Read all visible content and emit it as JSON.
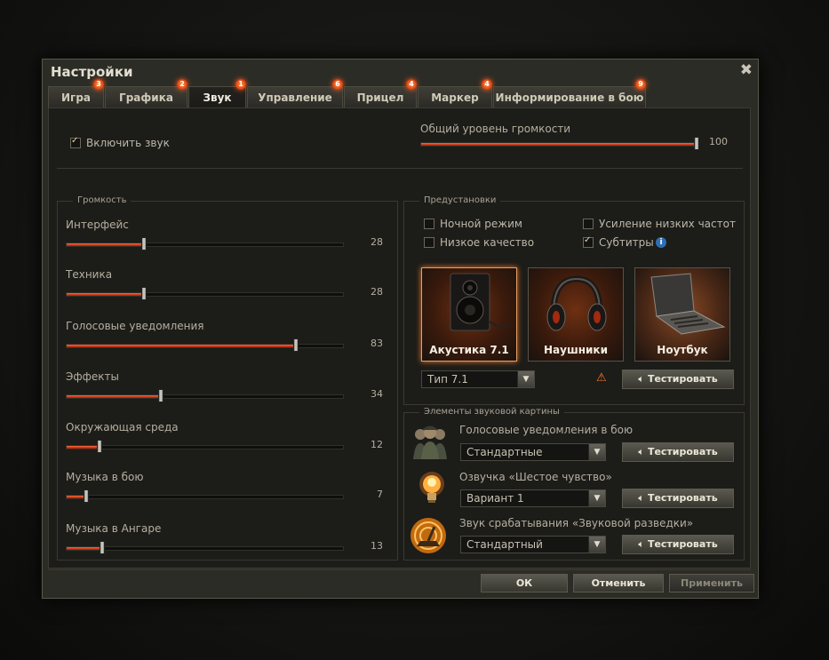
{
  "window": {
    "title": "Настройки"
  },
  "tabs": [
    {
      "label": "Игра",
      "badge": "3",
      "active": false
    },
    {
      "label": "Графика",
      "badge": "2",
      "active": false
    },
    {
      "label": "Звук",
      "badge": "1",
      "active": true
    },
    {
      "label": "Управление",
      "badge": "6",
      "active": false
    },
    {
      "label": "Прицел",
      "badge": "4",
      "active": false
    },
    {
      "label": "Маркер",
      "badge": "4",
      "active": false
    },
    {
      "label": "Информирование в бою",
      "badge": "9",
      "active": false
    }
  ],
  "enable_sound": {
    "label": "Включить звук",
    "checked": true
  },
  "master_volume": {
    "label": "Общий уровень громкости",
    "value": 100
  },
  "volume_group": {
    "title": "Громкость",
    "sliders": [
      {
        "label": "Интерфейс",
        "value": 28
      },
      {
        "label": "Техника",
        "value": 28
      },
      {
        "label": "Голосовые уведомления",
        "value": 83
      },
      {
        "label": "Эффекты",
        "value": 34
      },
      {
        "label": "Окружающая среда",
        "value": 12
      },
      {
        "label": "Музыка в бою",
        "value": 7
      },
      {
        "label": "Музыка в Ангаре",
        "value": 13
      }
    ]
  },
  "presets_group": {
    "title": "Предустановки",
    "checkboxes": {
      "night_mode": {
        "label": "Ночной режим",
        "checked": false
      },
      "bass_boost": {
        "label": "Усиление низких частот",
        "checked": false
      },
      "low_quality": {
        "label": "Низкое качество",
        "checked": false
      },
      "subtitles": {
        "label": "Субтитры",
        "checked": true
      }
    },
    "info_icon": "i",
    "devices": [
      {
        "label": "Акустика 7.1",
        "icon": "speaker-icon",
        "active": true
      },
      {
        "label": "Наушники",
        "icon": "headphones-icon",
        "active": false
      },
      {
        "label": "Ноутбук",
        "icon": "laptop-icon",
        "active": false
      }
    ],
    "type_select": "Тип 7.1",
    "warning_icon": "⚠",
    "test_label": "Тестировать"
  },
  "elements_group": {
    "title": "Элементы звуковой картины",
    "items": [
      {
        "label": "Голосовые уведомления в бою",
        "value": "Стандартные",
        "icon": "crew-icon"
      },
      {
        "label": "Озвучка «Шестое чувство»",
        "value": "Вариант 1",
        "icon": "lightbulb-icon"
      },
      {
        "label": "Звук срабатывания «Звуковой разведки»",
        "value": "Стандартный",
        "icon": "radar-icon"
      }
    ],
    "test_label": "Тестировать"
  },
  "footer": {
    "ok": "ОК",
    "cancel": "Отменить",
    "apply": "Применить"
  },
  "colors": {
    "accent": "#e05a1e",
    "slider_fill": "#c8320e",
    "panel": "#1c1c19"
  }
}
